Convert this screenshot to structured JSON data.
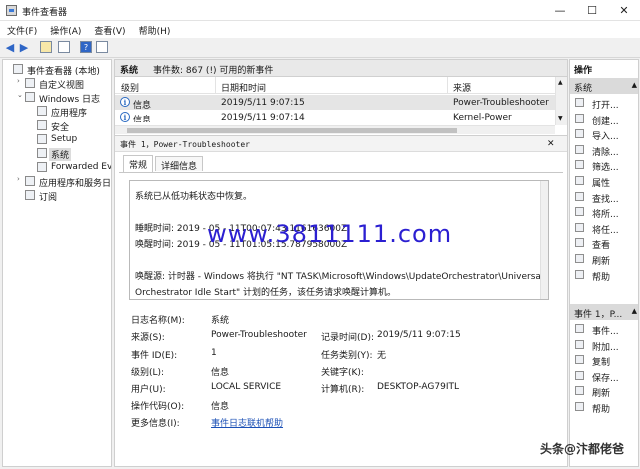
{
  "window": {
    "title": "事件查看器",
    "controls": [
      "—",
      "☐",
      "✕"
    ]
  },
  "menu": [
    "文件(F)",
    "操作(A)",
    "查看(V)",
    "帮助(H)"
  ],
  "tree": [
    {
      "label": "事件查看器 (本地)",
      "indent": 0,
      "twisty": ""
    },
    {
      "label": "自定义视图",
      "indent": 1,
      "twisty": "›"
    },
    {
      "label": "Windows 日志",
      "indent": 1,
      "twisty": "⌄"
    },
    {
      "label": "应用程序",
      "indent": 2,
      "twisty": ""
    },
    {
      "label": "安全",
      "indent": 2,
      "twisty": ""
    },
    {
      "label": "Setup",
      "indent": 2,
      "twisty": ""
    },
    {
      "label": "系统",
      "indent": 2,
      "twisty": "",
      "selected": true
    },
    {
      "label": "Forwarded Even",
      "indent": 2,
      "twisty": ""
    },
    {
      "label": "应用程序和服务日志",
      "indent": 1,
      "twisty": "›"
    },
    {
      "label": "订阅",
      "indent": 1,
      "twisty": ""
    }
  ],
  "list": {
    "title": "系统",
    "summary": "事件数: 867 (!) 可用的新事件",
    "columns": [
      "级别",
      "日期和时间",
      "来源"
    ],
    "rows": [
      {
        "level": "信息",
        "datetime": "2019/5/11 9:07:15",
        "source": "Power-Troubleshooter"
      },
      {
        "level": "信息",
        "datetime": "2019/5/11 9:07:14",
        "source": "Kernel-Power"
      }
    ]
  },
  "detail": {
    "header": "事件 1，Power-Troubleshooter",
    "close": "✕",
    "tabs": [
      "常规",
      "详细信息"
    ],
    "description": [
      "系统已从低功耗状态中恢复。",
      "",
      "睡眠时间:   2019  -  05  -  11T00:07:43.116163600Z",
      "唤醒时间:   2019  -  05  -  11T01:05:15.787958000Z",
      "",
      "唤醒源: 计时器 - Windows 将执行 \"NT TASK\\Microsoft\\Windows\\UpdateOrchestrator\\Universal",
      "Orchestrator Idle Start\" 计划的任务，该任务请求唤醒计算机。"
    ],
    "fields": {
      "log_name_label": "日志名称(M):",
      "log_name": "系统",
      "source_label": "来源(S):",
      "source": "Power-Troubleshooter",
      "logged_label": "记录时间(D):",
      "logged": "2019/5/11 9:07:15",
      "event_id_label": "事件 ID(E):",
      "event_id": "1",
      "task_label": "任务类别(Y):",
      "task": "无",
      "level_label": "级别(L):",
      "level": "信息",
      "keywords_label": "关键字(K):",
      "keywords": "",
      "user_label": "用户(U):",
      "user": "LOCAL SERVICE",
      "computer_label": "计算机(R):",
      "computer": "DESKTOP-AG79ITL",
      "opcode_label": "操作代码(O):",
      "opcode": "信息",
      "more_label": "更多信息(I):",
      "more_link": "事件日志联机帮助"
    }
  },
  "watermark": "www.3811111.com",
  "actions": {
    "title": "操作",
    "section1": "系统",
    "items1": [
      "打开...",
      "创建...",
      "导入...",
      "清除...",
      "筛选...",
      "属性",
      "查找...",
      "将所...",
      "将任...",
      "查看",
      "刷新",
      "帮助"
    ],
    "section2": "事件 1，P...",
    "items2": [
      "事件...",
      "附加...",
      "复制",
      "保存...",
      "刷新",
      "帮助"
    ]
  },
  "credit": "头条@汴都佬爸"
}
